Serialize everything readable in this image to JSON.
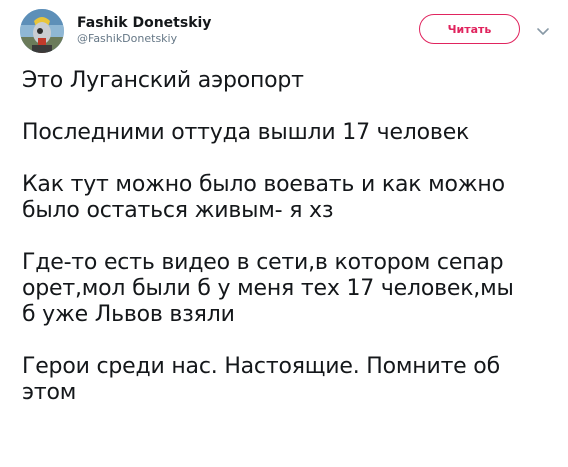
{
  "header": {
    "display_name": "Fashik Donetskiy",
    "handle": "@FashikDonetskiy",
    "follow_label": "Читать"
  },
  "icons": {
    "avatar": "avatar-image",
    "caret": "chevron-down-icon"
  },
  "colors": {
    "accent": "#e0245e",
    "text": "#14171a",
    "muted": "#657786"
  },
  "tweet": {
    "paragraphs": [
      "Это Луганский аэропорт",
      "Последними оттуда вышли 17 человек",
      "Как тут можно было воевать и как можно\nбыло остаться живым- я хз",
      "Где-то есть видео в сети,в котором сепар\nорет,мол были б у меня тех 17 человек,мы\nб уже Львов взяли",
      "Герои среди нас. Настоящие. Помните об\nэтом"
    ]
  }
}
